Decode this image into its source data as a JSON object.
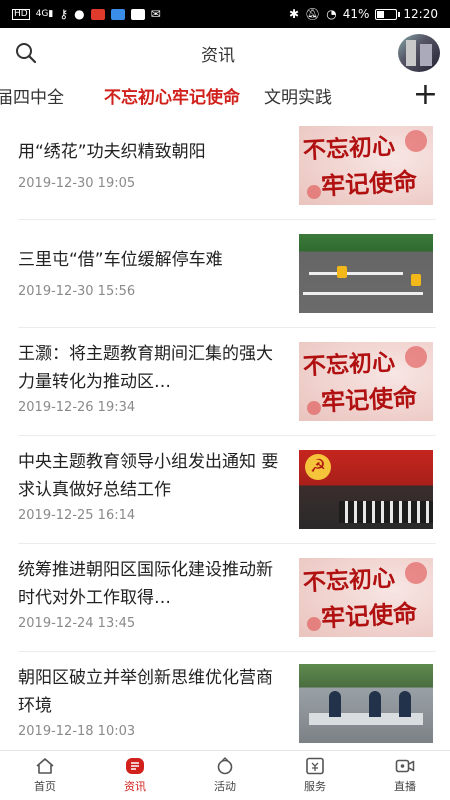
{
  "status": {
    "left_icons": [
      "hd-icon",
      "signal-4g-icon",
      "key-icon",
      "chat-icon",
      "app-red-icon",
      "app-blue-icon",
      "app-play-icon",
      "mail-icon"
    ],
    "right_icons": [
      "bluetooth-icon",
      "mute-icon",
      "wifi-icon"
    ],
    "battery": "41%",
    "battery_level": 0.41,
    "time": "12:20"
  },
  "header": {
    "title": "资讯"
  },
  "tabs": [
    {
      "label": "届四中全"
    },
    {
      "label": "不忘初心牢记使命",
      "active": true
    },
    {
      "label": "文明实践"
    }
  ],
  "plus_label": "+",
  "articles": [
    {
      "headline": "用“绣花”功夫织精致朝阳",
      "date": "2019-12-30 19:05",
      "thumb": "poster"
    },
    {
      "headline": "三里屯“借”车位缓解停车难",
      "date": "2019-12-30 15:56",
      "thumb": "parking"
    },
    {
      "headline": "王灏：将主题教育期间汇集的强大力量转化为推动区…",
      "date": "2019-12-26 19:34",
      "thumb": "poster"
    },
    {
      "headline": "中央主题教育领导小组发出通知 要求认真做好总结工作",
      "date": "2019-12-25 16:14",
      "thumb": "meeting"
    },
    {
      "headline": "统筹推进朝阳区国际化建设推动新时代对外工作取得…",
      "date": "2019-12-24 13:45",
      "thumb": "poster"
    },
    {
      "headline": "朝阳区破立并举创新思维优化营商环境",
      "date": "2019-12-18 10:03",
      "thumb": "office"
    }
  ],
  "poster_text": {
    "line1": "不忘初心",
    "line2": "牢记使命"
  },
  "nav": [
    {
      "label": "首页",
      "icon": "home-icon"
    },
    {
      "label": "资讯",
      "icon": "news-icon",
      "active": true
    },
    {
      "label": "活动",
      "icon": "activity-icon"
    },
    {
      "label": "服务",
      "icon": "service-icon"
    },
    {
      "label": "直播",
      "icon": "live-icon"
    }
  ],
  "colors": {
    "accent": "#d0211c",
    "text": "#222222",
    "muted": "#8a8a8a"
  }
}
